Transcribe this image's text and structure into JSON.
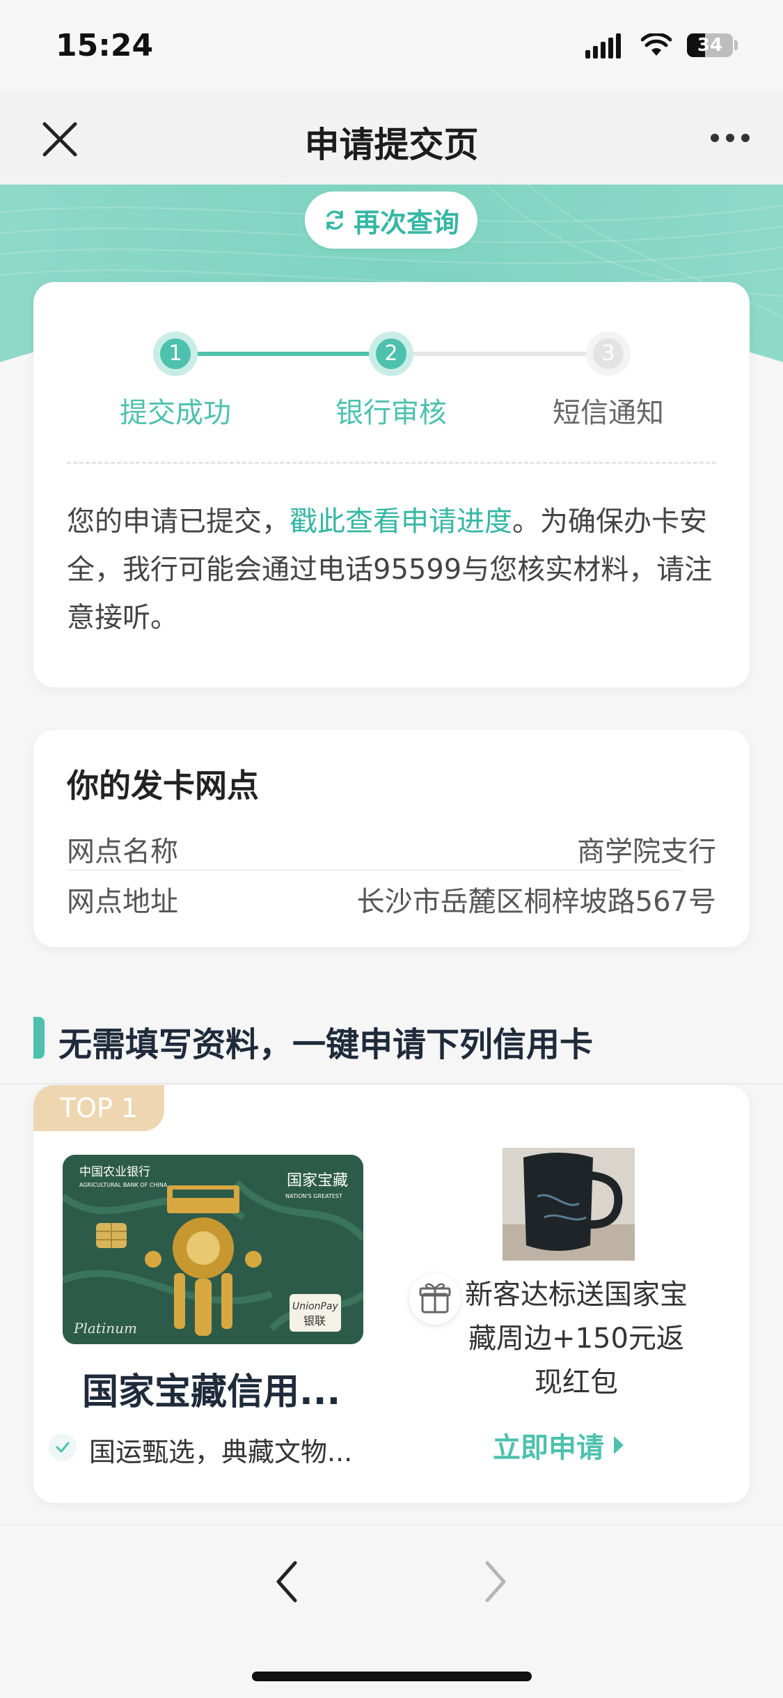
{
  "status_bar": {
    "time": "15:24",
    "battery": "34"
  },
  "nav": {
    "title": "申请提交页"
  },
  "banner": {
    "requery_label": "再次查询"
  },
  "progress": {
    "steps": [
      {
        "num": "1",
        "label": "提交成功"
      },
      {
        "num": "2",
        "label": "银行审核"
      },
      {
        "num": "3",
        "label": "短信通知"
      }
    ],
    "notice_pre": "您的申请已提交，",
    "notice_link": "戳此查看申请进度",
    "notice_post": "。为确保办卡安全，我行可能会通过电话95599与您核实材料，请注意接听。"
  },
  "branch": {
    "title": "你的发卡网点",
    "name_label": "网点名称",
    "name_value": "商学院支行",
    "address_label": "网点地址",
    "address_value": "长沙市岳麓区桐梓坡路567号"
  },
  "section": {
    "title": "无需填写资料，一键申请下列信用卡"
  },
  "offer": {
    "badge": "TOP 1",
    "card_name": "国家宝藏信用...",
    "card_desc": "国运甄选，典藏文物...",
    "gift_text": "新客达标送国家宝藏周边+150元返现红包",
    "apply_label": "立即申请",
    "card_art": {
      "bank_cn": "中国农业银行",
      "bank_en": "AGRICULTURAL BANK OF CHINA",
      "series_cn": "国家宝藏",
      "series_en": "NATION'S GREATEST",
      "tier": "Platinum",
      "network_en": "UnionPay",
      "network_cn": "银联"
    }
  },
  "colors": {
    "accent": "#4dc1ad",
    "accent_dark": "#35b7a3",
    "badge": "#edd6b0"
  }
}
